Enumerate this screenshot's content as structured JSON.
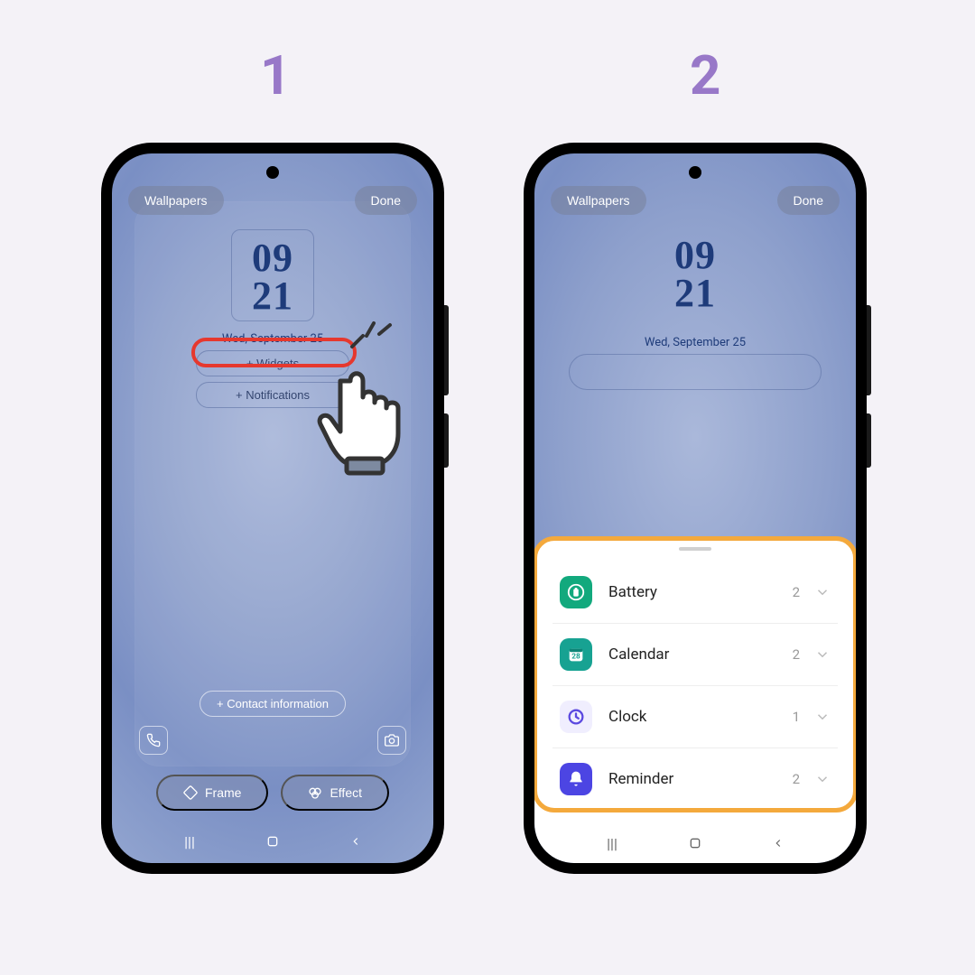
{
  "steps": {
    "one": "1",
    "two": "2"
  },
  "toolbar": {
    "wallpapers": "Wallpapers",
    "done": "Done"
  },
  "clock": {
    "hours": "09",
    "mins": "21"
  },
  "date": "Wed, September 25",
  "options": {
    "widgets": "Widgets",
    "notifications": "Notifications",
    "contact": "Contact information"
  },
  "editor": {
    "frame": "Frame",
    "effect": "Effect"
  },
  "plus": "+",
  "widget_sheet": {
    "items": [
      {
        "label": "Battery",
        "count": "2",
        "icon": "battery",
        "bg": "#12a97d",
        "fg": "#ffffff"
      },
      {
        "label": "Calendar",
        "count": "2",
        "icon": "calendar",
        "bg": "#17a292",
        "fg": "#ffffff",
        "day": "28"
      },
      {
        "label": "Clock",
        "count": "1",
        "icon": "clock",
        "bg": "#f0eefe",
        "fg": "#5b49e0"
      },
      {
        "label": "Reminder",
        "count": "2",
        "icon": "bell",
        "bg": "#4c45e3",
        "fg": "#ffffff"
      }
    ]
  }
}
